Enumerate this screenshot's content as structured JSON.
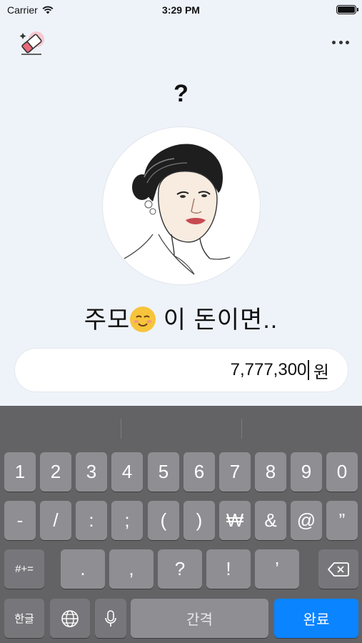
{
  "status": {
    "carrier": "Carrier",
    "time": "3:29 PM",
    "battery_level": 1.0
  },
  "header": {
    "eraser_icon": "eraser-icon",
    "more_icon": "more-dots-icon"
  },
  "question": "?",
  "portrait": {
    "icon": "portrait-illustration"
  },
  "caption": {
    "before": "주모",
    "emoji": "smiling-face-emoji",
    "after": "이 돈이면.."
  },
  "amount": {
    "value": "7,777,300",
    "unit": "원"
  },
  "keyboard": {
    "row1": [
      "1",
      "2",
      "3",
      "4",
      "5",
      "6",
      "7",
      "8",
      "9",
      "0"
    ],
    "row2": [
      "-",
      "/",
      ":",
      ";",
      "(",
      ")",
      "₩",
      "&",
      "@",
      "”"
    ],
    "row3_left": "#+=",
    "row3": [
      ".",
      ",",
      "?",
      "!",
      "’"
    ],
    "backspace_icon": "backspace-icon",
    "lang": "한글",
    "globe_icon": "globe-icon",
    "mic_icon": "microphone-icon",
    "space": "간격",
    "done": "완료"
  }
}
